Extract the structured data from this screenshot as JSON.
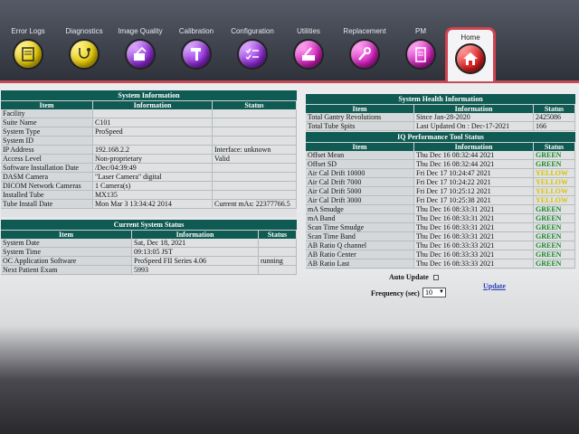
{
  "toolbar": {
    "items": [
      {
        "label": "Error Logs",
        "icon": "log-icon",
        "color": "yellow"
      },
      {
        "label": "Diagnostics",
        "icon": "stethoscope-icon",
        "color": "yellow"
      },
      {
        "label": "Image Quality",
        "icon": "phantom-icon",
        "color": "purple"
      },
      {
        "label": "Calibration",
        "icon": "hammer-icon",
        "color": "purple"
      },
      {
        "label": "Configuration",
        "icon": "checklist-icon",
        "color": "purple"
      },
      {
        "label": "Utilities",
        "icon": "tools-icon",
        "color": "magenta"
      },
      {
        "label": "Replacement",
        "icon": "wrench-icon",
        "color": "magenta"
      },
      {
        "label": "PM",
        "icon": "clipboard-icon",
        "color": "magenta"
      }
    ],
    "home_label": "Home",
    "accent": "#d0424f"
  },
  "system_info": {
    "title": "System Information",
    "headers": [
      "Item",
      "Information",
      "Status"
    ],
    "rows": [
      [
        "Facility",
        "",
        ""
      ],
      [
        "Suite Name",
        "C101",
        ""
      ],
      [
        "System Type",
        "ProSpeed",
        ""
      ],
      [
        "System ID",
        "",
        ""
      ],
      [
        "IP Address",
        "192.168.2.2",
        "Interface: unknown"
      ],
      [
        "Access Level",
        "Non-proprietary",
        "Valid"
      ],
      [
        "Software Installation Date",
        "/Dec/04:39:49",
        ""
      ],
      [
        "DASM Camera",
        "\"Laser Camera\" digital",
        ""
      ],
      [
        "DICOM Network Cameras",
        "1 Camera(s)",
        ""
      ],
      [
        "Installed Tube",
        "MX135",
        ""
      ],
      [
        "Tube Install Date",
        "Mon Mar 3 13:34:42 2014",
        "Current mAs: 22377766.5"
      ]
    ]
  },
  "current_status": {
    "title": "Current System Status",
    "headers": [
      "Item",
      "Information",
      "Status"
    ],
    "rows": [
      [
        "System Date",
        "Sat, Dec 18, 2021",
        ""
      ],
      [
        "System Time",
        "09:13:05 JST",
        ""
      ],
      [
        "OC Application Software",
        "ProSpeed FII Series 4.06",
        "running"
      ],
      [
        "Next Patient Exam",
        "5993",
        ""
      ]
    ]
  },
  "health": {
    "title": "System Health Information",
    "headers": [
      "Item",
      "Information",
      "Status"
    ],
    "rows": [
      [
        "Total Gantry Revolutions",
        "Since Jan-28-2020",
        "2425086"
      ],
      [
        "Total Tube Spits",
        "Last Updated On : Dec-17-2021",
        "166"
      ]
    ]
  },
  "iq_tool": {
    "title": "IQ Performance Tool Status",
    "headers": [
      "Item",
      "Information",
      "Status"
    ],
    "rows": [
      [
        "Offset Mean",
        "Thu Dec 16 08:32:44 2021",
        "GREEN"
      ],
      [
        "Offset SD",
        "Thu Dec 16 08:32:44 2021",
        "GREEN"
      ],
      [
        "Air Cal Drift 10000",
        "Fri Dec 17 10:24:47 2021",
        "YELLOW"
      ],
      [
        "Air Cal Drift 7000",
        "Fri Dec 17 10:24:22 2021",
        "YELLOW"
      ],
      [
        "Air Cal Drift 5000",
        "Fri Dec 17 10:25:12 2021",
        "YELLOW"
      ],
      [
        "Air Cal Drift 3000",
        "Fri Dec 17 10:25:38 2021",
        "YELLOW"
      ],
      [
        "mA Smudge",
        "Thu Dec 16 08:33:31 2021",
        "GREEN"
      ],
      [
        "mA Band",
        "Thu Dec 16 08:33:31 2021",
        "GREEN"
      ],
      [
        "Scan Time Smudge",
        "Thu Dec 16 08:33:31 2021",
        "GREEN"
      ],
      [
        "Scan Time Band",
        "Thu Dec 16 08:33:31 2021",
        "GREEN"
      ],
      [
        "AB Ratio Q channel",
        "Thu Dec 16 08:33:33 2021",
        "GREEN"
      ],
      [
        "AB Ratio Center",
        "Thu Dec 16 08:33:33 2021",
        "GREEN"
      ],
      [
        "AB Ratio Last",
        "Thu Dec 16 08:33:33 2021",
        "GREEN"
      ]
    ]
  },
  "controls": {
    "auto_update_label": "Auto Update",
    "frequency_label": "Frequency (sec)",
    "frequency_value": "10",
    "update_link": "Update"
  }
}
